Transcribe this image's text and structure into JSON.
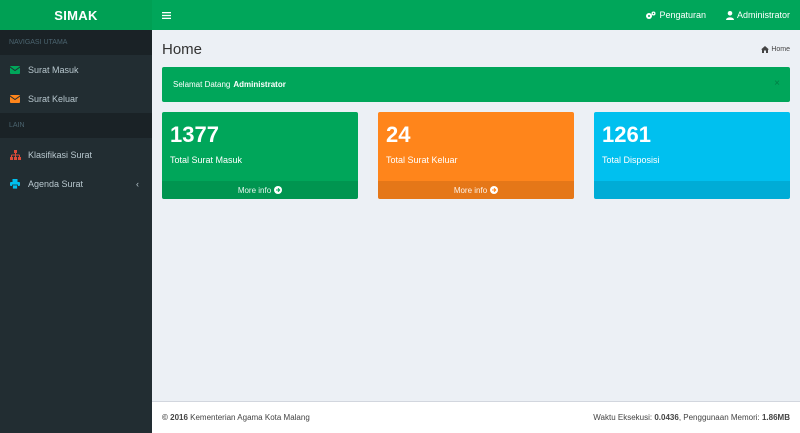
{
  "app": {
    "logo": "SIMAK"
  },
  "topbar": {
    "settings_label": "Pengaturan",
    "user_label": "Administrator"
  },
  "sidebar": {
    "header_main": "NAVIGASI UTAMA",
    "header_other": "LAIN",
    "items": [
      {
        "label": "Surat Masuk",
        "icon": "envelope-icon",
        "color": "#00a65a"
      },
      {
        "label": "Surat Keluar",
        "icon": "envelope-icon",
        "color": "#ff851b"
      },
      {
        "label": "Klasifikasi Surat",
        "icon": "sitemap-icon",
        "color": "#dd4b39"
      },
      {
        "label": "Agenda Surat",
        "icon": "print-icon",
        "color": "#00c0ef"
      }
    ]
  },
  "content": {
    "title": "Home",
    "breadcrumb": "Home",
    "alert_text": "Selamat Datang",
    "alert_user": "Administrator",
    "alert_close": "×"
  },
  "boxes": [
    {
      "value": "1377",
      "label": "Total Surat Masuk",
      "footer": "More info",
      "color": "#00a65a"
    },
    {
      "value": "24",
      "label": "Total Surat Keluar",
      "footer": "More info",
      "color": "#ff851b"
    },
    {
      "value": "1261",
      "label": "Total Disposisi",
      "footer": "",
      "color": "#00c0ef"
    }
  ],
  "footer": {
    "copyright_year": "© 2016",
    "org": "Kementerian Agama Kota Malang",
    "exec_label": "Waktu Eksekusi:",
    "exec_value": "0.0436",
    "mem_label": ", Penggunaan Memori:",
    "mem_value": "1.86MB"
  }
}
